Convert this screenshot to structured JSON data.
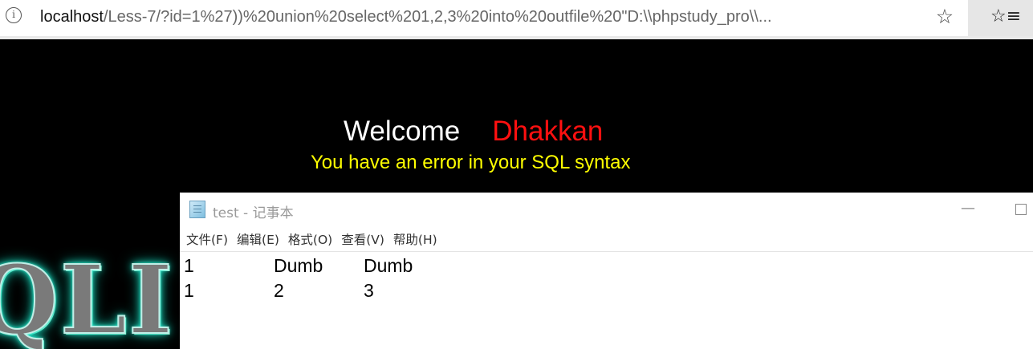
{
  "browser": {
    "url_host": "localhost",
    "url_path": "/Less-7/?id=1%27))%20union%20select%201,2,3%20into%20outfile%20\"D:\\\\phpstudy_pro\\\\...",
    "info_icon": "i",
    "favorite_icon": "☆",
    "favorites_panel_icon": "☆≡"
  },
  "page": {
    "welcome_label": "Welcome",
    "welcome_name": "Dhakkan",
    "error_message": "You have an error in your SQL syntax",
    "logo_text": "QLI"
  },
  "notepad": {
    "title": "test - 记事本",
    "menu": [
      "文件(F)",
      "编辑(E)",
      "格式(O)",
      "查看(V)",
      "帮助(H)"
    ],
    "rows": [
      [
        "1",
        "Dumb",
        "Dumb"
      ],
      [
        "1",
        "2",
        "3"
      ]
    ]
  },
  "colors": {
    "welcome": "#ffffff",
    "name": "#ff1010",
    "error": "#ffff00",
    "logo_glow": "#20e8c8"
  }
}
